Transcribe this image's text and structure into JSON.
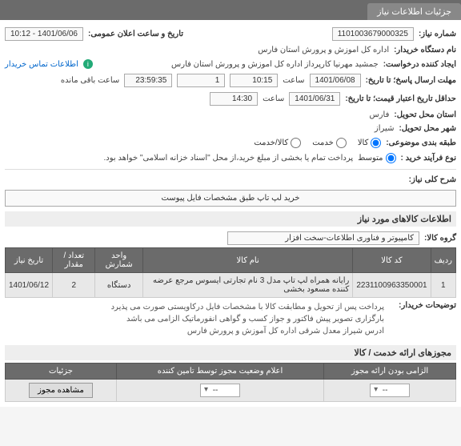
{
  "tab": {
    "title": "جزئیات اطلاعات نیاز"
  },
  "fields": {
    "req_no_lbl": "شماره نیاز:",
    "req_no": "1101003679000325",
    "pub_time_lbl": "تاریخ و ساعت اعلان عمومی:",
    "pub_time": "1401/06/06 - 10:12",
    "buyer_lbl": "نام دستگاه خریدار:",
    "buyer": "اداره کل اموزش و پرورش استان فارس",
    "creator_lbl": "ایجاد کننده درخواست:",
    "creator": "جمشید مهرنیا کارپرداز اداره کل اموزش و پرورش استان فارس",
    "contact_link": "اطلاعات تماس خریدار",
    "reply_deadline_lbl": "مهلت ارسال پاسخ؛ تا تاریخ:",
    "reply_date": "1401/06/08",
    "time_lbl": "ساعت",
    "reply_time": "10:15",
    "remain_days": "1",
    "remain_hms": "23:59:35",
    "remain_suffix": "ساعت باقی مانده",
    "validity_lbl": "حداقل تاریخ اعتبار قیمت؛ تا تاریخ:",
    "validity_date": "1401/06/31",
    "validity_time": "14:30",
    "province_lbl": "استان محل تحویل:",
    "province": "فارس",
    "city_lbl": "شهر محل تحویل:",
    "city": "شیراز",
    "category_lbl": "طبقه بندی موضوعی:",
    "cat_goods": "کالا",
    "cat_service": "خدمت",
    "cat_both": "کالا/خدمت",
    "process_lbl": "نوع فرآیند خرید :",
    "proc_mid": "متوسط",
    "proc_note": "پرداخت تمام یا بخشی از مبلغ خرید،از محل \"اسناد خزانه اسلامی\" خواهد بود.",
    "desc_lbl": "شرح کلی نیاز:",
    "desc": "خرید لپ تاپ طبق مشخصات فایل پیوست"
  },
  "goods_section": "اطلاعات کالاهای مورد نیاز",
  "group_lbl": "گروه کالا:",
  "group": "کامپیوتر و فناوری اطلاعات-سخت افزار",
  "table": {
    "headers": {
      "row": "ردیف",
      "code": "کد کالا",
      "name": "نام کالا",
      "unit": "واحد شمارش",
      "qty": "تعداد / مقدار",
      "date": "تاریخ نیاز"
    },
    "rows": [
      {
        "row": "1",
        "code": "2231100963350001",
        "name": "رایانه همراه لپ تاپ مدل 3 نام تجارتی ایسوس مرجع عرضه کننده مسعود بخشی",
        "unit": "دستگاه",
        "qty": "2",
        "date": "1401/06/12"
      }
    ]
  },
  "buyer_notes_lbl": "توضیحات خریدار:",
  "buyer_notes_1": "پرداخت پس از تحویل و مطابقت کالا با مشخصات فایل درکاویستی صورت می پذیرد",
  "buyer_notes_2": "بارگزاری تصویر پیش فاکتور و جواز کسب و گواهی انفورماتیک الزامی می باشد",
  "buyer_notes_3": "ادرس شیراز معدل شرقی اداره کل آموزش و پرورش فارس",
  "cert_section": "مجوزهای ارائه خدمت / کالا",
  "cert_table": {
    "h1": "الزامی بودن ارائه مجوز",
    "h2": "اعلام وضعیت مجوز توسط تامین کننده",
    "h3": "جزئیات",
    "sel_placeholder": "--",
    "btn": "مشاهده مجوز"
  }
}
